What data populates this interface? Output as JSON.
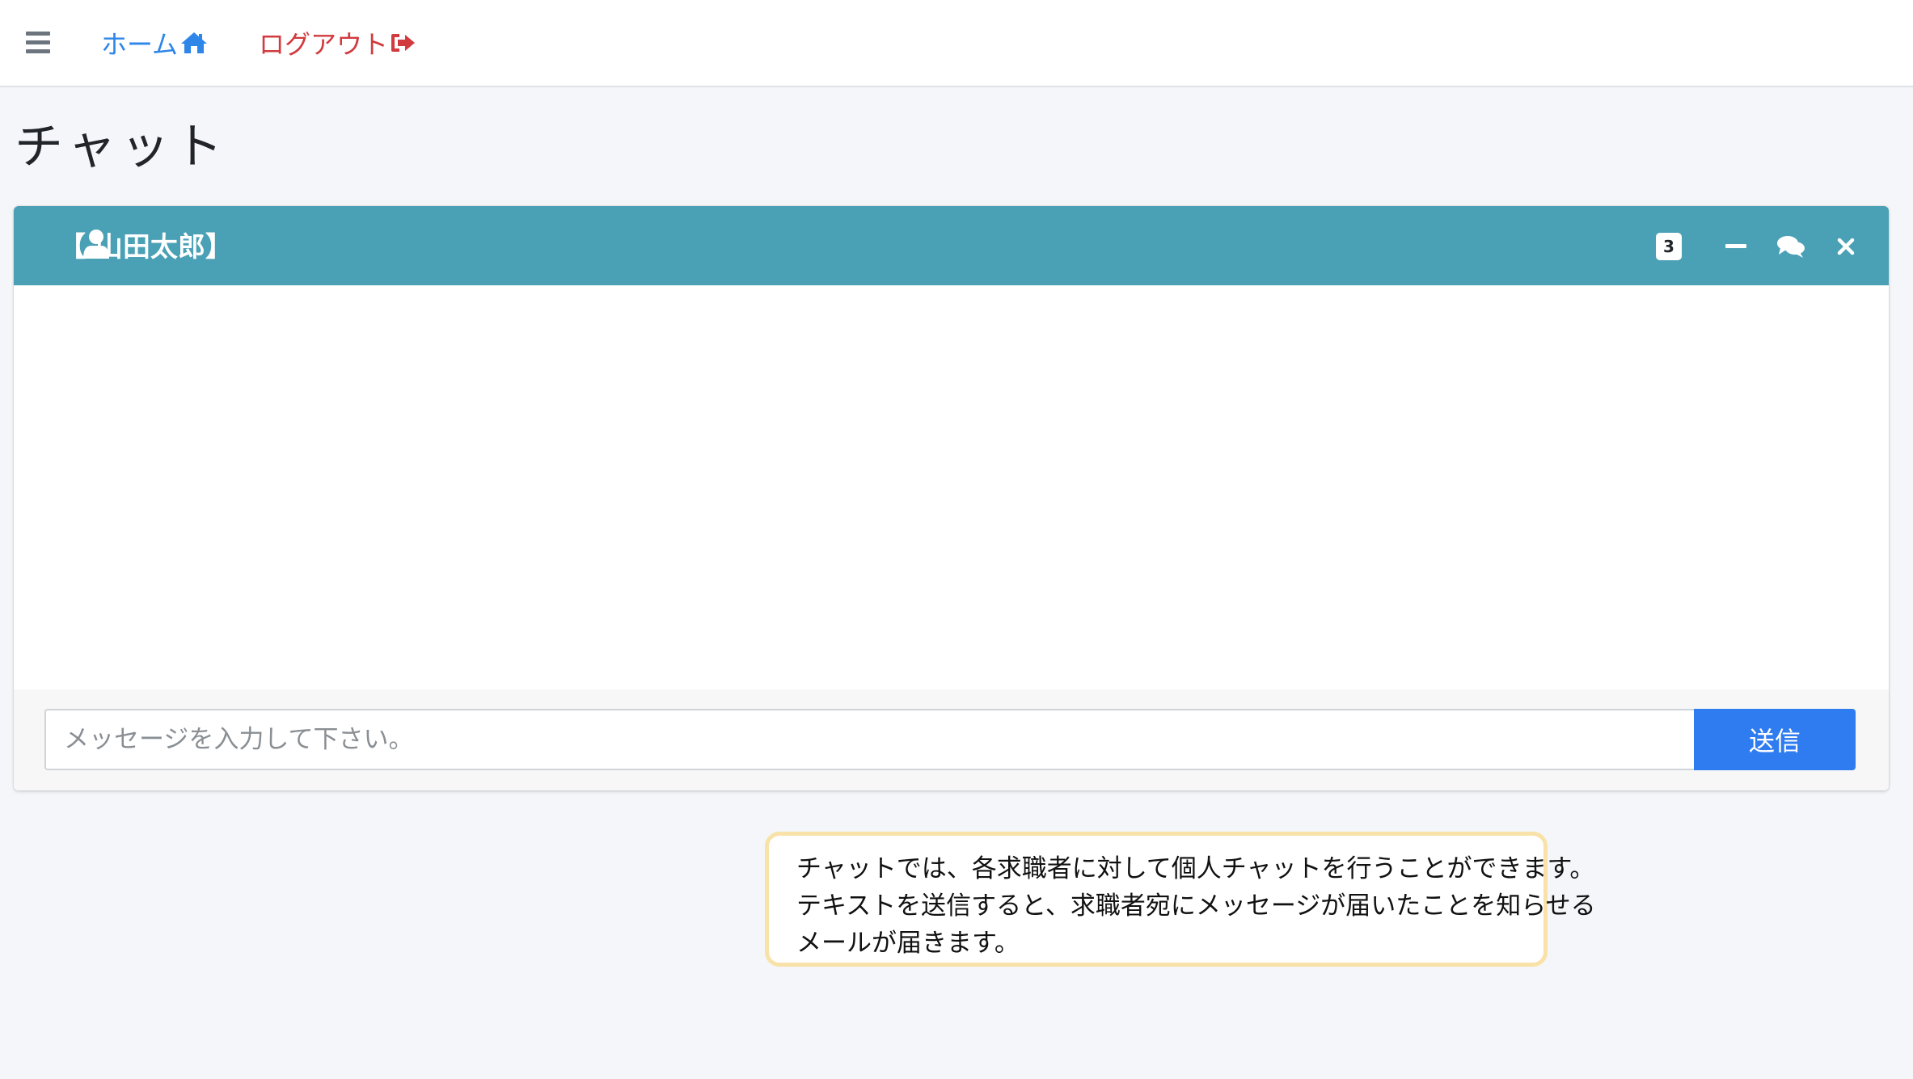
{
  "nav": {
    "home_label": "ホーム",
    "logout_label": "ログアウト",
    "home_color": "#2e86e8",
    "logout_color": "#d13b3f",
    "menu_icon": "hamburger-icon",
    "home_icon": "home-icon",
    "logout_icon": "sign-out-icon"
  },
  "page": {
    "title": "チャット"
  },
  "chat": {
    "header_color": "#4aa0b5",
    "user_name": "【 山田太郎】",
    "user_icon": "user-icon",
    "badge_count": "3",
    "tools": [
      "minus-icon",
      "comments-icon",
      "close-icon"
    ],
    "input_placeholder": "メッセージを入力して下さい。",
    "send_label": "送信",
    "send_color": "#2f7cf0"
  },
  "note": {
    "border_color": "#f8e2a8",
    "lines": [
      "チャットでは、各求職者に対して個人チャットを行うことができます。",
      "テキストを送信すると、求職者宛にメッセージが届いたことを知らせる",
      "メールが届きます。"
    ]
  }
}
